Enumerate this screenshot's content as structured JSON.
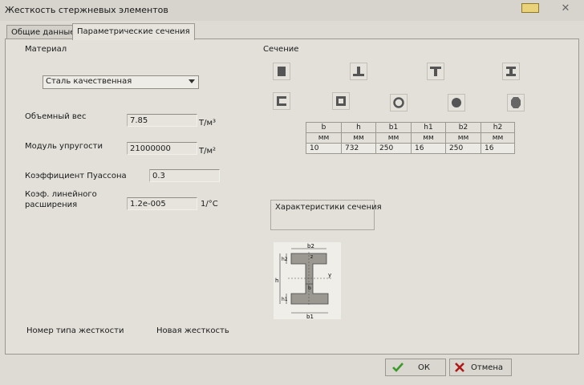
{
  "window": {
    "title": "Жесткость стержневых элементов"
  },
  "tabs": [
    {
      "label": "Общие данные",
      "active": false
    },
    {
      "label": "Параметрические сечения",
      "active": true
    }
  ],
  "material": {
    "group_label": "Материал",
    "select_value": "Сталь качественная",
    "rows": [
      {
        "label": "Объемный вес",
        "value": "7.85",
        "unit": "Т/м³"
      },
      {
        "label": "Модуль упругости",
        "value": "21000000",
        "unit": "Т/м²"
      },
      {
        "label": "Коэффициент Пуассона",
        "value": "0.3",
        "unit": ""
      },
      {
        "label_line1": "Коэф. линейного",
        "label_line2": "расширения",
        "value": "1.2e-005",
        "unit": "1/°C"
      }
    ]
  },
  "section": {
    "group_label": "Сечение",
    "shape_icons": [
      "rectangle-section-icon",
      "inverted-t-section-icon",
      "t-section-icon",
      "i-beam-section-icon",
      "channel-section-icon",
      "box-section-icon",
      "ring-section-icon",
      "circle-section-icon",
      "custom-section-icon"
    ],
    "selected_shape": "i-beam-section-icon",
    "params": {
      "headers": [
        "b",
        "h",
        "b1",
        "h1",
        "b2",
        "h2"
      ],
      "units": [
        "мм",
        "мм",
        "мм",
        "мм",
        "мм",
        "мм"
      ],
      "values": [
        "10",
        "732",
        "250",
        "16",
        "250",
        "16"
      ]
    },
    "characteristics_label": "Характеристики сечения",
    "sketch_labels": {
      "b2": "b2",
      "h2": "h2",
      "h": "h",
      "h1": "h1",
      "b1": "b1",
      "b": "b",
      "y": "y",
      "z": "z"
    }
  },
  "stiffness": {
    "type_number_label": "Номер типа жесткости",
    "new_label": "Новая жесткость"
  },
  "footer": {
    "ok_label": "ОК",
    "cancel_label": "Отмена"
  },
  "colors": {
    "ok_check": "#3a9a2a",
    "cancel_x": "#b01818"
  }
}
